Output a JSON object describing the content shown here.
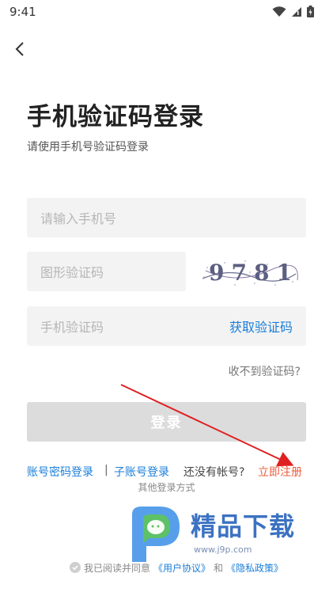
{
  "status_bar": {
    "time": "9:41"
  },
  "header": {
    "title": "手机验证码登录",
    "subtitle": "请使用手机号验证码登录"
  },
  "form": {
    "phone_placeholder": "请输入手机号",
    "graphic_code_placeholder": "图形验证码",
    "captcha_text": "9781",
    "sms_code_placeholder": "手机验证码",
    "get_code_label": "获取验证码",
    "no_code_link": "收不到验证码?",
    "login_label": "登录"
  },
  "links": {
    "password_login": "账号密码登录",
    "separator": "|",
    "sub_account_login": "子账号登录",
    "no_account": "还没有帐号?",
    "register": "立即注册",
    "other_methods": "其他登录方式"
  },
  "agreement": {
    "prefix": "我已阅读并同意",
    "user_agreement": "《用户协议》",
    "and": "和",
    "privacy_policy": "《隐私政策》"
  },
  "watermark": {
    "name": "精品下载",
    "url": "www.j9p.com"
  },
  "colors": {
    "link_blue": "#1a7ed8",
    "register_red": "#ec5c3e",
    "input_bg": "#f3f3f3",
    "button_disabled": "#dcdcdc",
    "annotation_arrow": "#e02020"
  },
  "icons": {
    "back": "chevron-left-icon",
    "wifi": "wifi-icon",
    "signal": "signal-icon",
    "battery": "battery-icon",
    "checkbox": "check-circle-icon"
  }
}
